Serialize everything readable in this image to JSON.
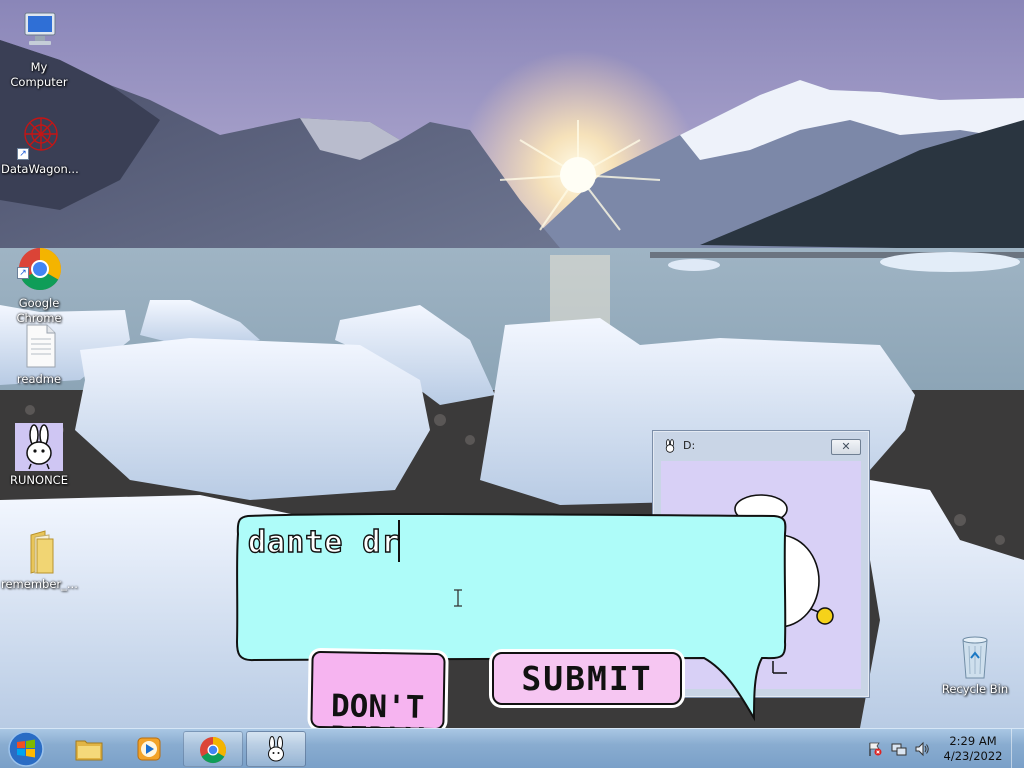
{
  "desktop": {
    "icons": [
      {
        "label": "My Computer",
        "icon": "my-computer-icon"
      },
      {
        "label": "DataWagon...",
        "icon": "datawagon-icon"
      },
      {
        "label": "Google\nChrome",
        "icon": "chrome-icon"
      },
      {
        "label": "readme",
        "icon": "text-file-icon"
      },
      {
        "label": "RUNONCE",
        "icon": "bunny-icon"
      },
      {
        "label": "remember_...",
        "icon": "folder-icon"
      },
      {
        "label": "Recycle Bin",
        "icon": "recycle-bin-icon"
      }
    ]
  },
  "dwindow": {
    "title": "D:",
    "close_symbol": "✕"
  },
  "dialog": {
    "input_text": "dante dr",
    "dont_reply_label": "DON'T\nREPLY",
    "submit_label": "SUBMIT"
  },
  "taskbar": {
    "items": [
      "start-orb",
      "windows-explorer",
      "media-player",
      "google-chrome",
      "runonce"
    ],
    "clock_time": "2:29 AM",
    "clock_date": "4/23/2022"
  },
  "colors": {
    "bubble": "#aefcf9",
    "button_pink": "#f6b4f0",
    "window_client": "#d8d0f6"
  }
}
